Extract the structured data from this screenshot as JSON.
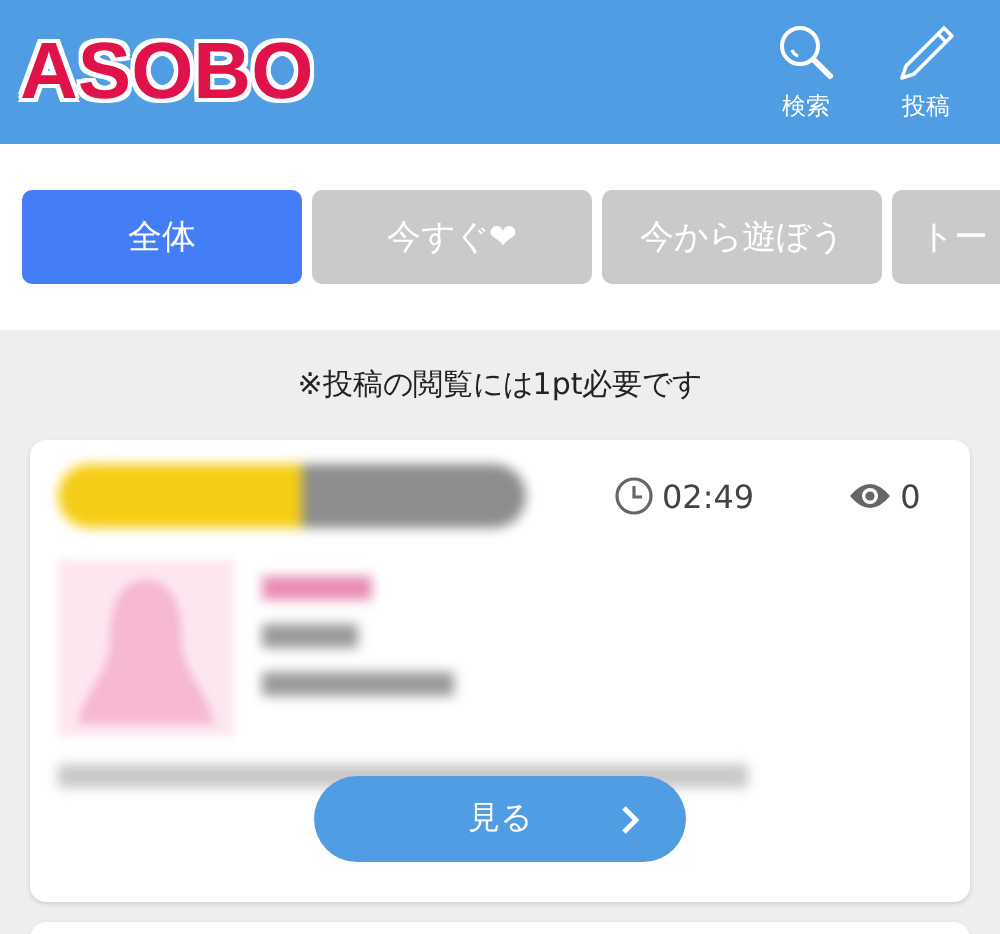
{
  "header": {
    "logo": "ASOBO",
    "actions": [
      {
        "kind": "search",
        "label": "検索"
      },
      {
        "kind": "post",
        "label": "投稿"
      }
    ]
  },
  "tabs": [
    {
      "label": "全体",
      "selected": true
    },
    {
      "label": "今すぐ❤",
      "selected": false
    },
    {
      "label": "今から遊ぼう",
      "selected": false
    },
    {
      "label": "トー",
      "selected": false
    }
  ],
  "notice": "※投稿の閲覧には1pt必要です",
  "posts": [
    {
      "time": "02:49",
      "views": "0",
      "button": "見る"
    }
  ]
}
